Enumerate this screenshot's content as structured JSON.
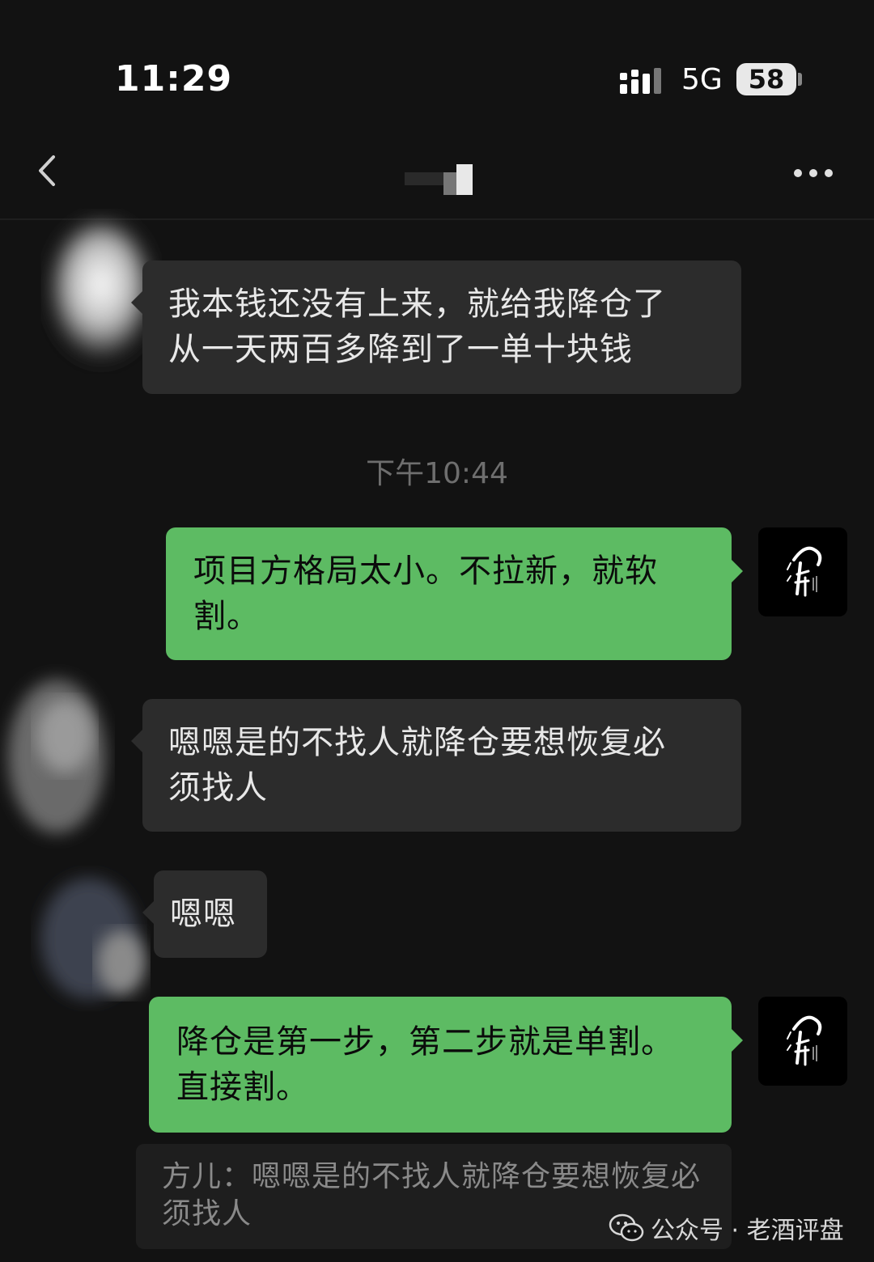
{
  "status_bar": {
    "time": "11:29",
    "network": "5G",
    "battery": "58"
  },
  "nav": {
    "title": ""
  },
  "messages": [
    {
      "lines": [
        "我本钱还没有上来，就给我降仓了",
        "从一天两百多降到了一单十块钱"
      ]
    },
    {
      "lines": [
        "项目方格局太小。不拉新，就软",
        "割。"
      ]
    },
    {
      "lines": [
        "嗯嗯是的不找人就降仓要想恢复必",
        "须找人"
      ]
    },
    {
      "lines": [
        "嗯嗯"
      ]
    },
    {
      "lines": [
        "降仓是第一步，第二步就是单割。",
        "直接割。"
      ]
    }
  ],
  "timestamp": "下午10:44",
  "quote": {
    "lines": [
      "方儿：嗯嗯是的不找人就降仓要想恢复必",
      "须找人"
    ]
  },
  "watermark": {
    "text": "公众号 · 老酒评盘"
  },
  "colors": {
    "outgoing_bubble": "#5dbb63",
    "incoming_bubble": "#2c2c2c",
    "background": "#121212"
  }
}
